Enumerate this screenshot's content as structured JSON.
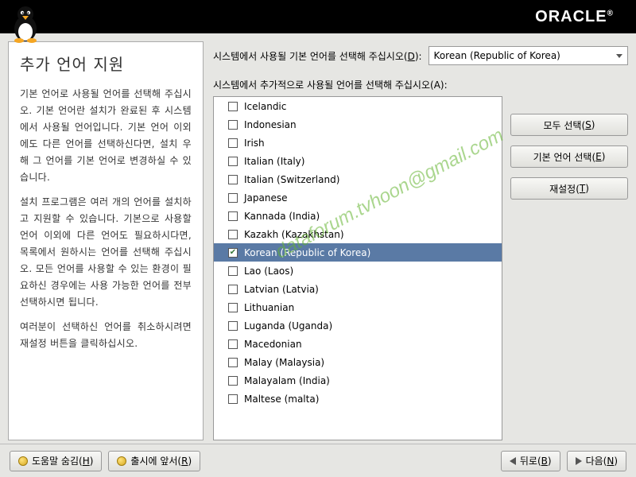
{
  "header": {
    "brand": "ORACLE"
  },
  "left": {
    "title": "추가 언어 지원",
    "p1": "기본 언어로 사용될 언어를 선택해 주십시오. 기본 언어란 설치가 완료된 후 시스템에서 사용될 언어입니다. 기본 언어 이외에도 다른 언어를 선택하신다면, 설치 우해 그 언어를 기본 언어로 변경하실 수 있습니다.",
    "p2": "설치 프로그램은 여러 개의 언어를 설치하고 지원할 수 있습니다. 기본으로 사용할 언어 이외에 다른 언어도 필요하시다면, 목록에서 원하시는 언어를 선택해 주십시오. 모든 언어를 사용할 수 있는 환경이 필요하신 경우에는 사용 가능한 언어를 전부 선택하시면 됩니다.",
    "p3": "여러분이 선택하신 언어를 취소하시려면 재설정 버튼을 클릭하십시오."
  },
  "top": {
    "label_pre": "시스템에서 사용될 기본 언어를 선택해 주십시오(",
    "label_key": "D",
    "label_post": "):",
    "selected": "Korean (Republic of Korea)"
  },
  "list": {
    "label_pre": "시스템에서 추가적으로 사용될 언어를 선택해 주십시오(",
    "label_key": "A",
    "label_post": "):",
    "items": [
      {
        "label": "Icelandic",
        "checked": false,
        "selected": false
      },
      {
        "label": "Indonesian",
        "checked": false,
        "selected": false
      },
      {
        "label": "Irish",
        "checked": false,
        "selected": false
      },
      {
        "label": "Italian (Italy)",
        "checked": false,
        "selected": false
      },
      {
        "label": "Italian (Switzerland)",
        "checked": false,
        "selected": false
      },
      {
        "label": "Japanese",
        "checked": false,
        "selected": false
      },
      {
        "label": "Kannada (India)",
        "checked": false,
        "selected": false
      },
      {
        "label": "Kazakh (Kazakhstan)",
        "checked": false,
        "selected": false
      },
      {
        "label": "Korean (Republic of Korea)",
        "checked": true,
        "selected": true
      },
      {
        "label": "Lao (Laos)",
        "checked": false,
        "selected": false
      },
      {
        "label": "Latvian (Latvia)",
        "checked": false,
        "selected": false
      },
      {
        "label": "Lithuanian",
        "checked": false,
        "selected": false
      },
      {
        "label": "Luganda (Uganda)",
        "checked": false,
        "selected": false
      },
      {
        "label": "Macedonian",
        "checked": false,
        "selected": false
      },
      {
        "label": "Malay (Malaysia)",
        "checked": false,
        "selected": false
      },
      {
        "label": "Malayalam (India)",
        "checked": false,
        "selected": false
      },
      {
        "label": "Maltese (malta)",
        "checked": false,
        "selected": false
      }
    ]
  },
  "buttons": {
    "select_all_pre": "모두 선택(",
    "select_all_key": "S",
    "select_all_post": ")",
    "select_default_pre": "기본 언어 선택(",
    "select_default_key": "E",
    "select_default_post": ")",
    "reset_pre": "재설정(",
    "reset_key": "T",
    "reset_post": ")"
  },
  "footer": {
    "hide_help_pre": "도움말 숨김(",
    "hide_help_key": "H",
    "hide_help_post": ")",
    "release_notes_pre": "출시에 앞서(",
    "release_notes_key": "R",
    "release_notes_post": ")",
    "back_pre": "뒤로(",
    "back_key": "B",
    "back_post": ")",
    "next_pre": "다음(",
    "next_key": "N",
    "next_post": ")"
  },
  "watermark": "dataforum.tvhoon@gmail.com"
}
